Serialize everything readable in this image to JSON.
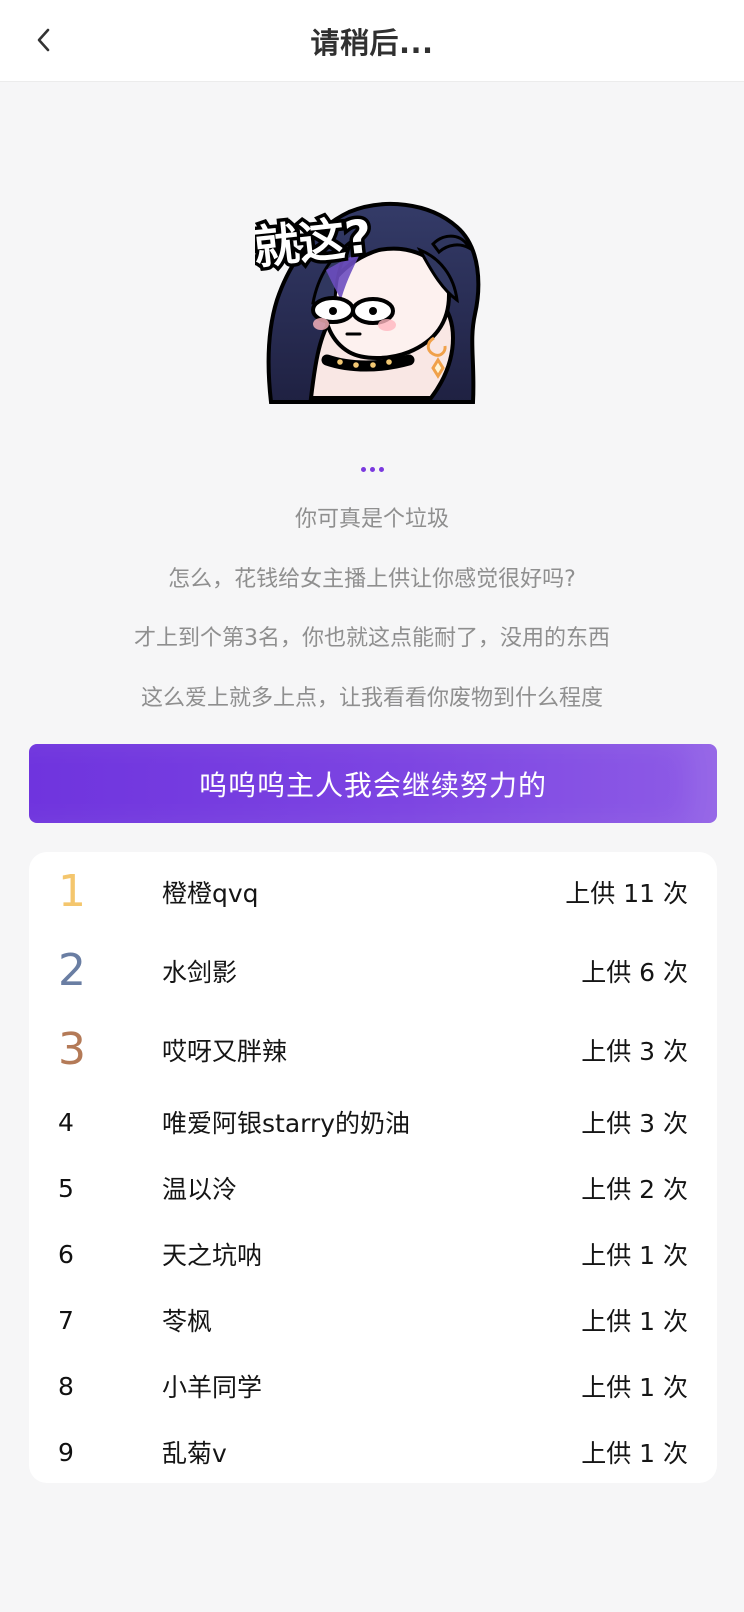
{
  "header": {
    "title": "请稍后..."
  },
  "icons": {
    "back": "back-chevron-icon",
    "sticker": "anime-girl-sticker-icon"
  },
  "sticker": {
    "text": "就这?"
  },
  "messages": [
    "你可真是个垃圾",
    "怎么，花钱给女主播上供让你感觉很好吗?",
    "才上到个第3名，你也就这点能耐了，没用的东西",
    "这么爱上就多上点，让我看看你废物到什么程度"
  ],
  "cta": {
    "label": "呜呜呜主人我会继续努力的"
  },
  "colors": {
    "accent": "#7b39df",
    "gold": "#f4c66d",
    "silver": "#6a7ea3",
    "bronze": "#b47a57"
  },
  "rankings": [
    {
      "rank": "1",
      "name": "橙橙qvq",
      "count": "上供 11 次"
    },
    {
      "rank": "2",
      "name": "水剑影",
      "count": "上供 6 次"
    },
    {
      "rank": "3",
      "name": "哎呀又胖辣",
      "count": "上供 3 次"
    },
    {
      "rank": "4",
      "name": "唯爱阿银starry的奶油",
      "count": "上供 3 次"
    },
    {
      "rank": "5",
      "name": "温以泠",
      "count": "上供 2 次"
    },
    {
      "rank": "6",
      "name": "天之坑呐",
      "count": "上供 1 次"
    },
    {
      "rank": "7",
      "name": "苓枫",
      "count": "上供 1 次"
    },
    {
      "rank": "8",
      "name": "小羊同学",
      "count": "上供 1 次"
    },
    {
      "rank": "9",
      "name": "乱菊v",
      "count": "上供 1 次"
    }
  ]
}
